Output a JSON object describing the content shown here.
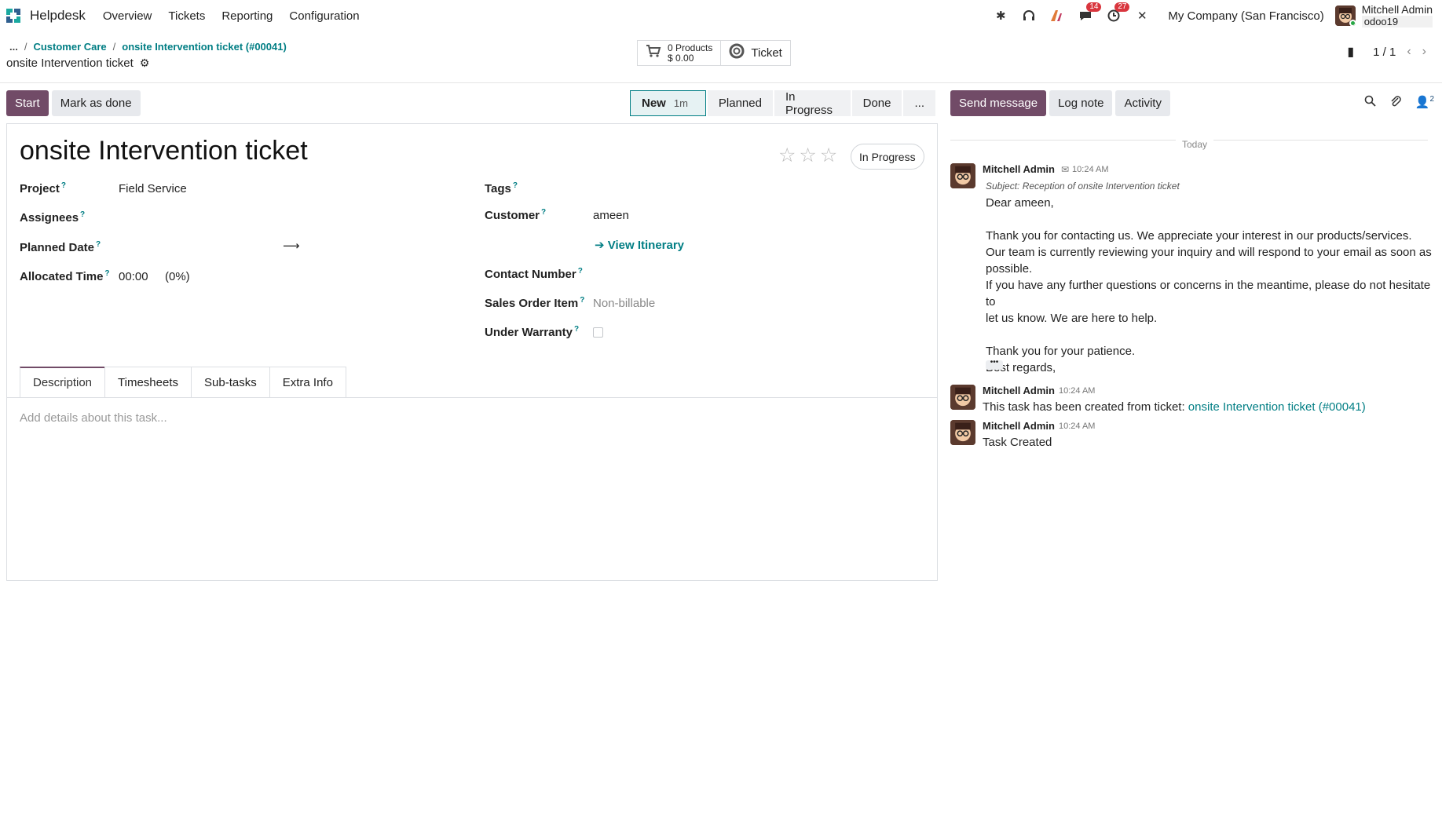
{
  "navbar": {
    "app_name": "Helpdesk",
    "menu": [
      "Overview",
      "Tickets",
      "Reporting",
      "Configuration"
    ],
    "chat_badge": "14",
    "activity_badge": "27",
    "company": "My Company (San Francisco)",
    "user_name": "Mitchell Admin",
    "user_db": "odoo19"
  },
  "breadcrumb": {
    "dots": "...",
    "parent": "Customer Care",
    "current": "onsite Intervention ticket (#00041)"
  },
  "record_title": "onsite Intervention ticket",
  "smart_buttons": {
    "products_line1": "0 Products",
    "products_line2": "$ 0.00",
    "ticket_label": "Ticket"
  },
  "pager": {
    "value": "1 / 1"
  },
  "statusbar": {
    "start_label": "Start",
    "done_label": "Mark as done",
    "stages": [
      {
        "label": "New",
        "duration": "1m"
      },
      {
        "label": "Planned"
      },
      {
        "label": "In Progress"
      },
      {
        "label": "Done"
      },
      {
        "label": "..."
      }
    ]
  },
  "form": {
    "title": "onsite Intervention ticket",
    "stage_badge": "In Progress",
    "fields": {
      "project_label": "Project",
      "project_value": "Field Service",
      "assignees_label": "Assignees",
      "planned_date_label": "Planned Date",
      "allocated_time_label": "Allocated Time",
      "allocated_time_value": "00:00",
      "allocated_time_pct": "(0%)",
      "tags_label": "Tags",
      "customer_label": "Customer",
      "customer_value": "ameen",
      "view_itinerary": "View Itinerary",
      "contact_number_label": "Contact Number",
      "sales_order_item_label": "Sales Order Item",
      "sales_order_item_value": "Non-billable",
      "under_warranty_label": "Under Warranty",
      "help_mark": "?"
    },
    "tabs": [
      "Description",
      "Timesheets",
      "Sub-tasks",
      "Extra Info"
    ],
    "description_placeholder": "Add details about this task..."
  },
  "chatter": {
    "send_message": "Send message",
    "log_note": "Log note",
    "activity": "Activity",
    "followers_count": "2",
    "today": "Today",
    "messages": [
      {
        "author": "Mitchell Admin",
        "time": "10:24 AM",
        "subject": "Subject: Reception of onsite Intervention ticket",
        "lines": [
          "Dear ameen,",
          "",
          "Thank you for contacting us. We appreciate your interest in our products/services.",
          "Our team is currently reviewing your inquiry and will respond to your email as soon as",
          "possible.",
          "If you have any further questions or concerns in the meantime, please do not hesitate to",
          "let us know. We are here to help.",
          "",
          "Thank you for your patience.",
          "Best regards,"
        ]
      },
      {
        "author": "Mitchell Admin",
        "time": "10:24 AM",
        "text": "This task has been created from ticket: ",
        "link": "onsite Intervention ticket (#00041)"
      },
      {
        "author": "Mitchell Admin",
        "time": "10:24 AM",
        "text": "Task Created"
      }
    ]
  }
}
